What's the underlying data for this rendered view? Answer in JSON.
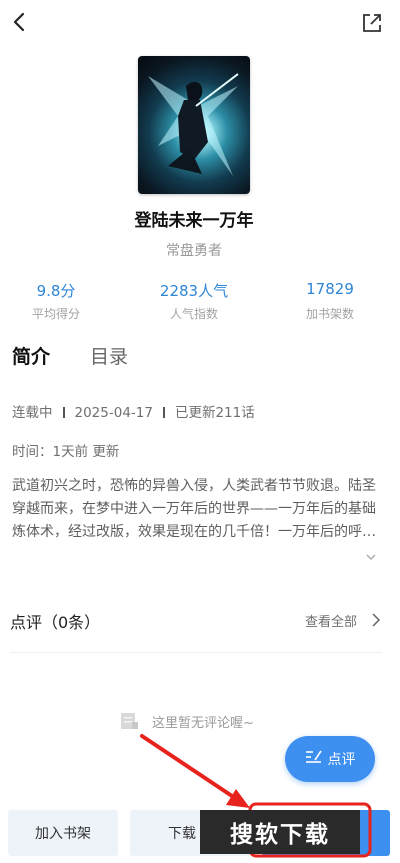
{
  "book": {
    "title": "登陆未来一万年",
    "author": "常盘勇者"
  },
  "stats": [
    {
      "value": "9.8分",
      "label": "平均得分"
    },
    {
      "value": "2283人气",
      "label": "人气指数"
    },
    {
      "value": "17829",
      "label": "加书架数"
    }
  ],
  "tabs": {
    "intro": "简介",
    "catalog": "目录"
  },
  "meta": {
    "status": "连载中",
    "date": "2025-04-17",
    "updated": "已更新211话",
    "time": "时间：1天前 更新"
  },
  "description": "武道初兴之时，恐怖的异兽入侵，人类武者节节败退。陆圣穿越而来，在梦中进入一万年后的世界——一万年后的基础炼体术，经过改版，效果是现在的几千倍！一万年后的呼吸法、炼体药方、武学圣典...",
  "reviews": {
    "title": "点评（0条）",
    "view_all": "查看全部",
    "empty": "这里暂无评论喔~",
    "button": "点评"
  },
  "bottom": {
    "add_shelf": "加入书架",
    "download": "下载"
  },
  "watermark": "搜软下载",
  "colors": {
    "accent": "#3d8ff0",
    "stat_blue": "#2f86d6",
    "annotation_red": "#e8231e"
  },
  "icons": [
    "back-icon",
    "share-icon",
    "expand-chevron-icon",
    "chevron-right-icon",
    "empty-comment-icon",
    "write-review-icon",
    "red-arrow-annotation"
  ]
}
